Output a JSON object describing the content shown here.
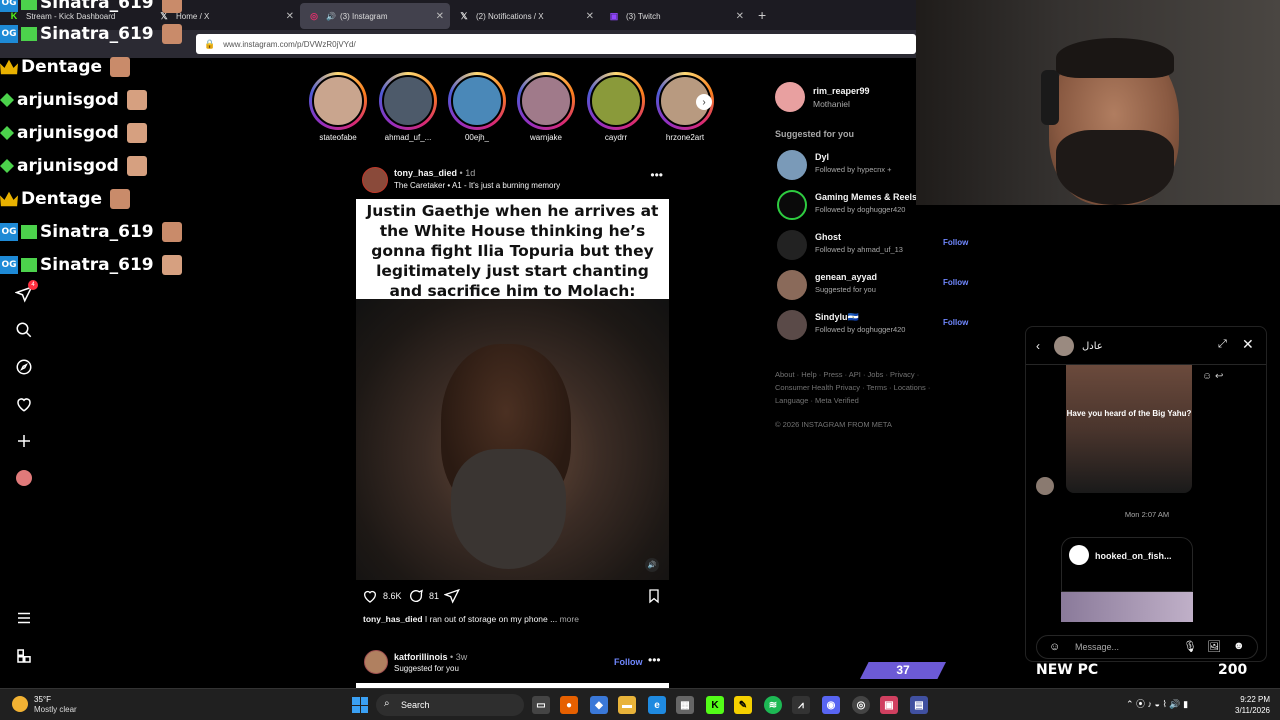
{
  "browser": {
    "tabs": [
      {
        "label": "Stream - Kick Dashboard",
        "icon": "kick-icon",
        "color": "#53fc18"
      },
      {
        "label": "Home / X",
        "icon": "x-icon",
        "color": "#ffffff"
      },
      {
        "label": "(3) Instagram",
        "icon": "instagram-icon",
        "color": "#e1306c",
        "active": true
      },
      {
        "label": "(2) Notifications / X",
        "icon": "x-icon",
        "color": "#ffffff"
      },
      {
        "label": "(3) Twitch",
        "icon": "twitch-icon",
        "color": "#9146ff"
      }
    ],
    "new_tab": "+",
    "url": "www.instagram.com/p/DVWzR0jVYd/"
  },
  "overlay_chat": [
    {
      "user": "Sinatra_619",
      "badges": [
        "og",
        "gift"
      ]
    },
    {
      "user": "Sinatra_619",
      "badges": [
        "og",
        "gift"
      ]
    },
    {
      "user": "Dentage",
      "badges": [
        "crown"
      ]
    },
    {
      "user": "arjunisgod",
      "badges": [
        "diamond"
      ]
    },
    {
      "user": "arjunisgod",
      "badges": [
        "diamond"
      ]
    },
    {
      "user": "arjunisgod",
      "badges": [
        "diamond"
      ]
    },
    {
      "user": "Dentage",
      "badges": [
        "crown"
      ]
    },
    {
      "user": "Sinatra_619",
      "badges": [
        "og",
        "gift"
      ]
    },
    {
      "user": "Sinatra_619",
      "badges": [
        "og",
        "gift"
      ]
    }
  ],
  "ig_nav": {
    "icons": [
      "instagram-icon",
      "home-icon",
      "reels-icon",
      "messages-icon",
      "search-icon",
      "explore-icon",
      "notifications-icon",
      "create-icon",
      "profile-icon",
      "menu-icon",
      "also-from-meta-icon"
    ],
    "messages_badge": "4"
  },
  "stories": [
    "stateofabe",
    "ahmad_uf_...",
    "00ejh_",
    "warnjake",
    "caydrr",
    "hrzone2art"
  ],
  "post": {
    "username": "tony_has_died",
    "age": "1d",
    "audio": "The Caretaker • A1 - It's just a burning memory",
    "meme_text": "Justin Gaethje when he arrives at the White House thinking he’s gonna fight Ilia Topuria but they legitimately just start chanting and sacrifice him to Molach:",
    "likes": "8.6K",
    "comments": "81",
    "caption_user": "tony_has_died",
    "caption_text": "I ran out of storage on my phone ...",
    "caption_more": "more"
  },
  "post2": {
    "username": "katforillinois",
    "age": "3w",
    "subtitle": "Suggested for you",
    "follow": "Follow"
  },
  "sidebar": {
    "me_username": "rim_reaper99",
    "me_name": "Mothaniel",
    "suggested_title": "Suggested for you",
    "suggestions": [
      {
        "name": "Dyl",
        "sub": "Followed by hypecnx +",
        "follow": ""
      },
      {
        "name": "Gaming Memes & Reels",
        "sub": "Followed by doghugger420",
        "follow": "Follow"
      },
      {
        "name": "Ghost",
        "sub": "Followed by ahmad_uf_13",
        "follow": "Follow"
      },
      {
        "name": "genean_ayyad",
        "sub": "Suggested for you",
        "follow": "Follow"
      },
      {
        "name": "Sindylu🇸🇻",
        "sub": "Followed by doghugger420",
        "follow": "Follow"
      }
    ],
    "footer_links": "About · Help · Press · API · Jobs · Privacy · Consumer Health Privacy · Terms · Locations · Language · Meta Verified",
    "copyright": "© 2026 INSTAGRAM FROM META"
  },
  "dm": {
    "contact_name": "عادل",
    "reel_caption": "Have you heard of the Big Yahu?",
    "timestamp": "Mon 2:07 AM",
    "shared_account": "hooked_on_fish...",
    "placeholder": "Message..."
  },
  "stream_widgets": {
    "counter": "37",
    "goal_label": "NEW PC",
    "goal_value": "200"
  },
  "taskbar": {
    "temperature": "35°F",
    "weather": "Mostly clear",
    "search_label": "Search",
    "time": "9:22 PM",
    "date": "3/11/2026"
  }
}
